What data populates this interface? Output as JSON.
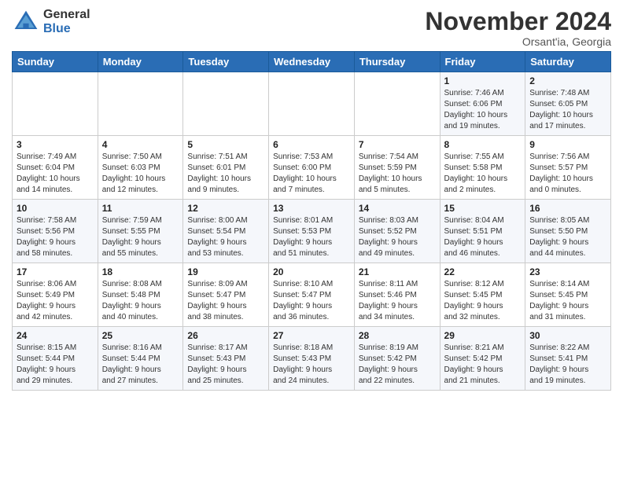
{
  "logo": {
    "line1": "General",
    "line2": "Blue"
  },
  "title": "November 2024",
  "location": "Orsant'ia, Georgia",
  "days_of_week": [
    "Sunday",
    "Monday",
    "Tuesday",
    "Wednesday",
    "Thursday",
    "Friday",
    "Saturday"
  ],
  "weeks": [
    [
      {
        "day": "",
        "info": ""
      },
      {
        "day": "",
        "info": ""
      },
      {
        "day": "",
        "info": ""
      },
      {
        "day": "",
        "info": ""
      },
      {
        "day": "",
        "info": ""
      },
      {
        "day": "1",
        "info": "Sunrise: 7:46 AM\nSunset: 6:06 PM\nDaylight: 10 hours\nand 19 minutes."
      },
      {
        "day": "2",
        "info": "Sunrise: 7:48 AM\nSunset: 6:05 PM\nDaylight: 10 hours\nand 17 minutes."
      }
    ],
    [
      {
        "day": "3",
        "info": "Sunrise: 7:49 AM\nSunset: 6:04 PM\nDaylight: 10 hours\nand 14 minutes."
      },
      {
        "day": "4",
        "info": "Sunrise: 7:50 AM\nSunset: 6:03 PM\nDaylight: 10 hours\nand 12 minutes."
      },
      {
        "day": "5",
        "info": "Sunrise: 7:51 AM\nSunset: 6:01 PM\nDaylight: 10 hours\nand 9 minutes."
      },
      {
        "day": "6",
        "info": "Sunrise: 7:53 AM\nSunset: 6:00 PM\nDaylight: 10 hours\nand 7 minutes."
      },
      {
        "day": "7",
        "info": "Sunrise: 7:54 AM\nSunset: 5:59 PM\nDaylight: 10 hours\nand 5 minutes."
      },
      {
        "day": "8",
        "info": "Sunrise: 7:55 AM\nSunset: 5:58 PM\nDaylight: 10 hours\nand 2 minutes."
      },
      {
        "day": "9",
        "info": "Sunrise: 7:56 AM\nSunset: 5:57 PM\nDaylight: 10 hours\nand 0 minutes."
      }
    ],
    [
      {
        "day": "10",
        "info": "Sunrise: 7:58 AM\nSunset: 5:56 PM\nDaylight: 9 hours\nand 58 minutes."
      },
      {
        "day": "11",
        "info": "Sunrise: 7:59 AM\nSunset: 5:55 PM\nDaylight: 9 hours\nand 55 minutes."
      },
      {
        "day": "12",
        "info": "Sunrise: 8:00 AM\nSunset: 5:54 PM\nDaylight: 9 hours\nand 53 minutes."
      },
      {
        "day": "13",
        "info": "Sunrise: 8:01 AM\nSunset: 5:53 PM\nDaylight: 9 hours\nand 51 minutes."
      },
      {
        "day": "14",
        "info": "Sunrise: 8:03 AM\nSunset: 5:52 PM\nDaylight: 9 hours\nand 49 minutes."
      },
      {
        "day": "15",
        "info": "Sunrise: 8:04 AM\nSunset: 5:51 PM\nDaylight: 9 hours\nand 46 minutes."
      },
      {
        "day": "16",
        "info": "Sunrise: 8:05 AM\nSunset: 5:50 PM\nDaylight: 9 hours\nand 44 minutes."
      }
    ],
    [
      {
        "day": "17",
        "info": "Sunrise: 8:06 AM\nSunset: 5:49 PM\nDaylight: 9 hours\nand 42 minutes."
      },
      {
        "day": "18",
        "info": "Sunrise: 8:08 AM\nSunset: 5:48 PM\nDaylight: 9 hours\nand 40 minutes."
      },
      {
        "day": "19",
        "info": "Sunrise: 8:09 AM\nSunset: 5:47 PM\nDaylight: 9 hours\nand 38 minutes."
      },
      {
        "day": "20",
        "info": "Sunrise: 8:10 AM\nSunset: 5:47 PM\nDaylight: 9 hours\nand 36 minutes."
      },
      {
        "day": "21",
        "info": "Sunrise: 8:11 AM\nSunset: 5:46 PM\nDaylight: 9 hours\nand 34 minutes."
      },
      {
        "day": "22",
        "info": "Sunrise: 8:12 AM\nSunset: 5:45 PM\nDaylight: 9 hours\nand 32 minutes."
      },
      {
        "day": "23",
        "info": "Sunrise: 8:14 AM\nSunset: 5:45 PM\nDaylight: 9 hours\nand 31 minutes."
      }
    ],
    [
      {
        "day": "24",
        "info": "Sunrise: 8:15 AM\nSunset: 5:44 PM\nDaylight: 9 hours\nand 29 minutes."
      },
      {
        "day": "25",
        "info": "Sunrise: 8:16 AM\nSunset: 5:44 PM\nDaylight: 9 hours\nand 27 minutes."
      },
      {
        "day": "26",
        "info": "Sunrise: 8:17 AM\nSunset: 5:43 PM\nDaylight: 9 hours\nand 25 minutes."
      },
      {
        "day": "27",
        "info": "Sunrise: 8:18 AM\nSunset: 5:43 PM\nDaylight: 9 hours\nand 24 minutes."
      },
      {
        "day": "28",
        "info": "Sunrise: 8:19 AM\nSunset: 5:42 PM\nDaylight: 9 hours\nand 22 minutes."
      },
      {
        "day": "29",
        "info": "Sunrise: 8:21 AM\nSunset: 5:42 PM\nDaylight: 9 hours\nand 21 minutes."
      },
      {
        "day": "30",
        "info": "Sunrise: 8:22 AM\nSunset: 5:41 PM\nDaylight: 9 hours\nand 19 minutes."
      }
    ]
  ]
}
